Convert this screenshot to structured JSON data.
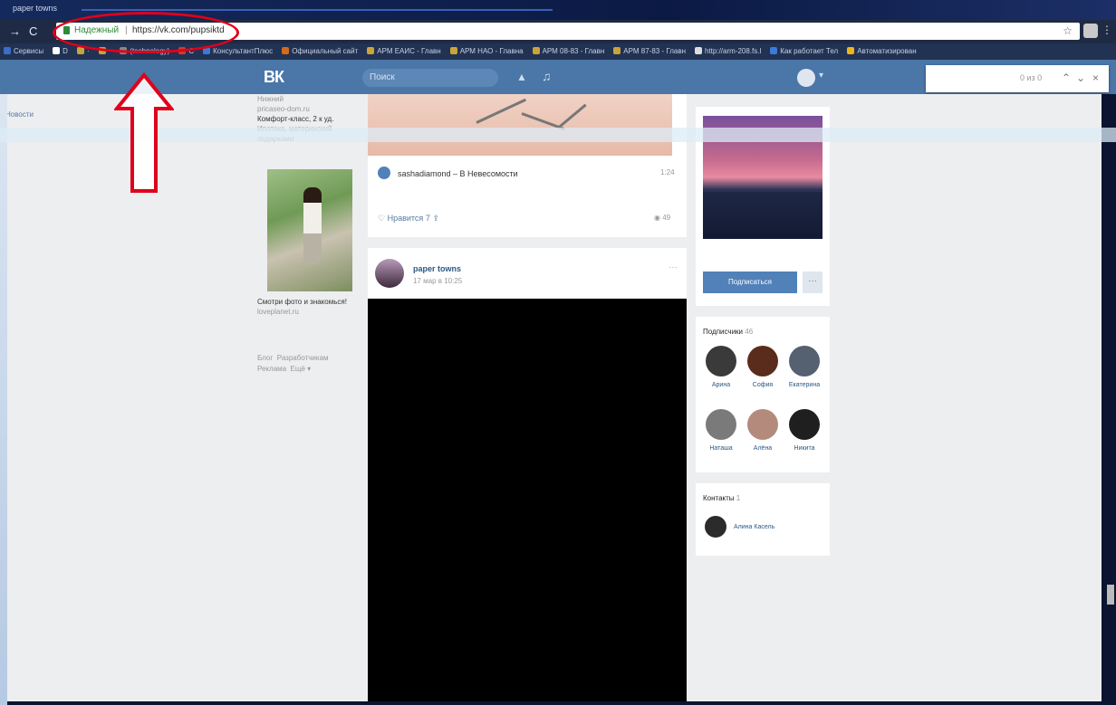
{
  "browser": {
    "tab_title": "paper towns",
    "nav": {
      "forward": "→",
      "reload": "C"
    },
    "address": {
      "secure_label": "Надежный",
      "url": "https://vk.com/pupsiktd"
    },
    "star": "☆",
    "bookmarks": [
      {
        "label": "Сервисы",
        "color": "#3b6ec9"
      },
      {
        "label": "D",
        "color": "#ffffff"
      },
      {
        "label": "·",
        "color": "#caa33a"
      },
      {
        "label": "·",
        "color": "#caa33a"
      },
      {
        "label": "(technology)",
        "color": "#888888"
      },
      {
        "label": "C",
        "color": "#d23b2b"
      },
      {
        "label": "КонсультантПлюс",
        "color": "#3a7ad8"
      },
      {
        "label": "Официальный сайт",
        "color": "#d36b1e"
      },
      {
        "label": "АРМ ЕАИС - Главн",
        "color": "#caa33a"
      },
      {
        "label": "АРМ НАО - Главна",
        "color": "#caa33a"
      },
      {
        "label": "АРМ 08-83 - Главн",
        "color": "#caa33a"
      },
      {
        "label": "АРМ 87-83 - Главн",
        "color": "#caa33a"
      },
      {
        "label": "http://arm-208.fs.l",
        "color": "#dddddd"
      },
      {
        "label": "Как работает Тел",
        "color": "#3a7ad8"
      },
      {
        "label": "Автоматизирован",
        "color": "#f0b31c"
      }
    ]
  },
  "vk": {
    "logo": "ВК",
    "search_placeholder": "Поиск",
    "icons": {
      "bell": "▲",
      "music": "♫",
      "dropdown": "▾"
    }
  },
  "find_bar": {
    "count": "0 из 0",
    "up": "⌃",
    "down": "⌄",
    "close": "×"
  },
  "left_nav": {
    "item": "Новости"
  },
  "ads": {
    "first": {
      "line1": "Нижний",
      "line2": "pricaseo-dom.ru",
      "line3": "Комфорт-класс, 2 к уд.",
      "line4": "Ипотека, материнский",
      "line5": "подарками"
    },
    "second": {
      "title": "Смотри фото и знакомься!",
      "domain": "loveplanet.ru"
    },
    "footer": [
      "Блог",
      "Разработчикам",
      "Реклама",
      "Ещё ▾"
    ]
  },
  "post1": {
    "audio": "sashadiamond – В Невесомости",
    "duration": "1:24",
    "likes_label": "Нравится",
    "likes_count": "7",
    "views": "49"
  },
  "post2": {
    "author": "paper towns",
    "date": "17 мар в 10:25",
    "menu": "···"
  },
  "profile": {
    "subscribe": "Подписаться",
    "more": "···"
  },
  "followers": {
    "title": "Подписчики",
    "count": "46",
    "people": [
      {
        "name": "Арина",
        "color": "#3a3a3a"
      },
      {
        "name": "София",
        "color": "#5a2c1c"
      },
      {
        "name": "Екатерина",
        "color": "#556070"
      },
      {
        "name": "Наташа",
        "color": "#7a7a7a"
      },
      {
        "name": "Алёна",
        "color": "#b48a7c"
      },
      {
        "name": "Никита",
        "color": "#1f1f1f"
      }
    ]
  },
  "contacts": {
    "title": "Контакты",
    "count": "1",
    "person": "Алина Касель"
  }
}
